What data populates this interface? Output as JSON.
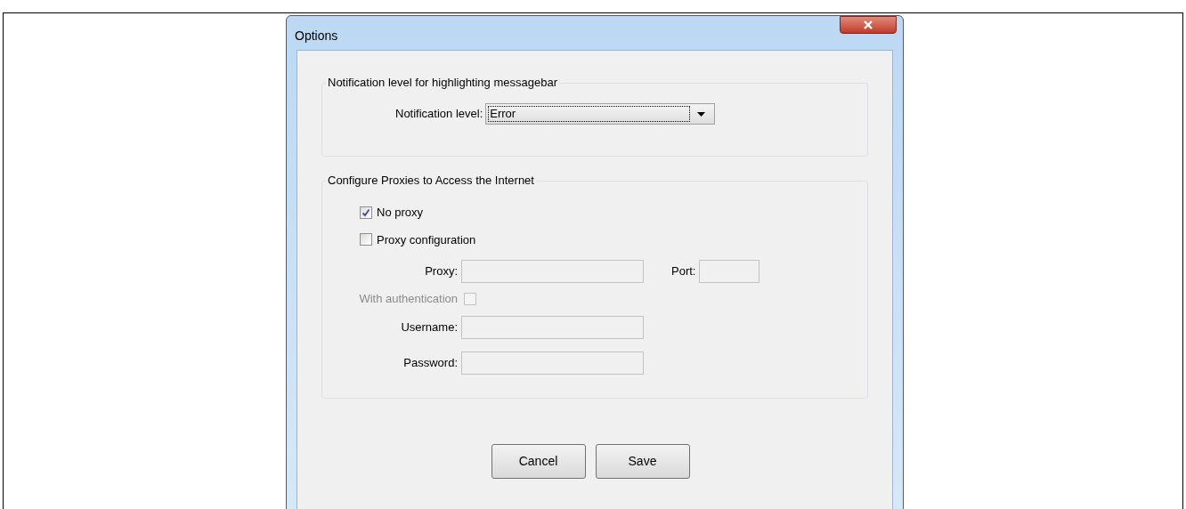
{
  "window": {
    "title": "Options"
  },
  "notification_group": {
    "title": "Notification level for highlighting messagebar",
    "label": "Notification level:",
    "value": "Error"
  },
  "proxy_group": {
    "title": "Configure Proxies to Access the Internet",
    "options": [
      {
        "label": "No proxy",
        "checked": true
      },
      {
        "label": "Proxy configuration",
        "checked": false
      }
    ],
    "proxy": {
      "label": "Proxy:"
    },
    "port": {
      "label": "Port:"
    },
    "auth": {
      "label": "With authentication",
      "checked": false,
      "disabled": true
    },
    "username": {
      "label": "Username:"
    },
    "password": {
      "label": "Password:"
    }
  },
  "buttons": [
    "Cancel",
    "Save"
  ]
}
